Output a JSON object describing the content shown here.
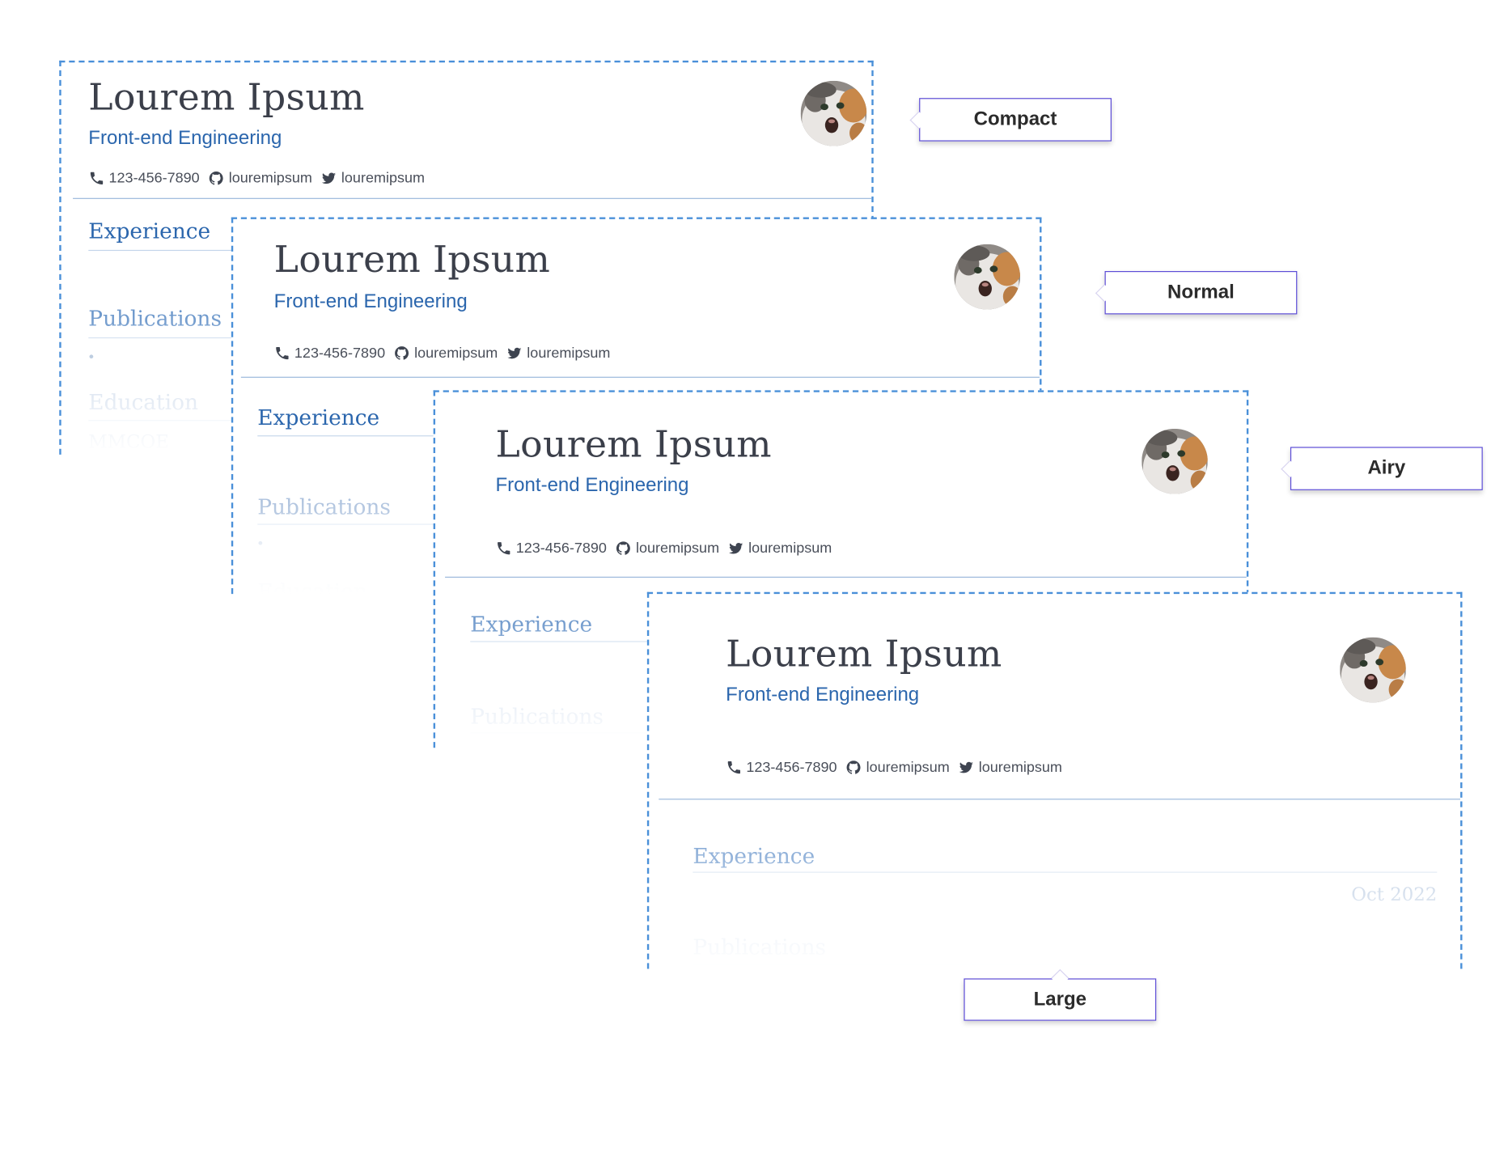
{
  "resume": {
    "name": "Lourem Ipsum",
    "role": "Front-end Engineering",
    "phone": "123-456-7890",
    "github": "louremipsum",
    "twitter": "louremipsum"
  },
  "sections": {
    "experience": "Experience",
    "publications": "Publications",
    "education": "Education",
    "school": "MMCOE",
    "date": "Oct 2022"
  },
  "labels": {
    "compact": "Compact",
    "normal": "Normal",
    "airy": "Airy",
    "large": "Large"
  },
  "icons": {
    "phone": "phone-icon",
    "github": "github-icon",
    "twitter": "twitter-icon",
    "avatar": "cat-avatar"
  },
  "colors": {
    "accent": "#2b66ad",
    "border": "#4a90d9",
    "callout_border": "#5b4bd6",
    "text": "#3b3f4a"
  }
}
